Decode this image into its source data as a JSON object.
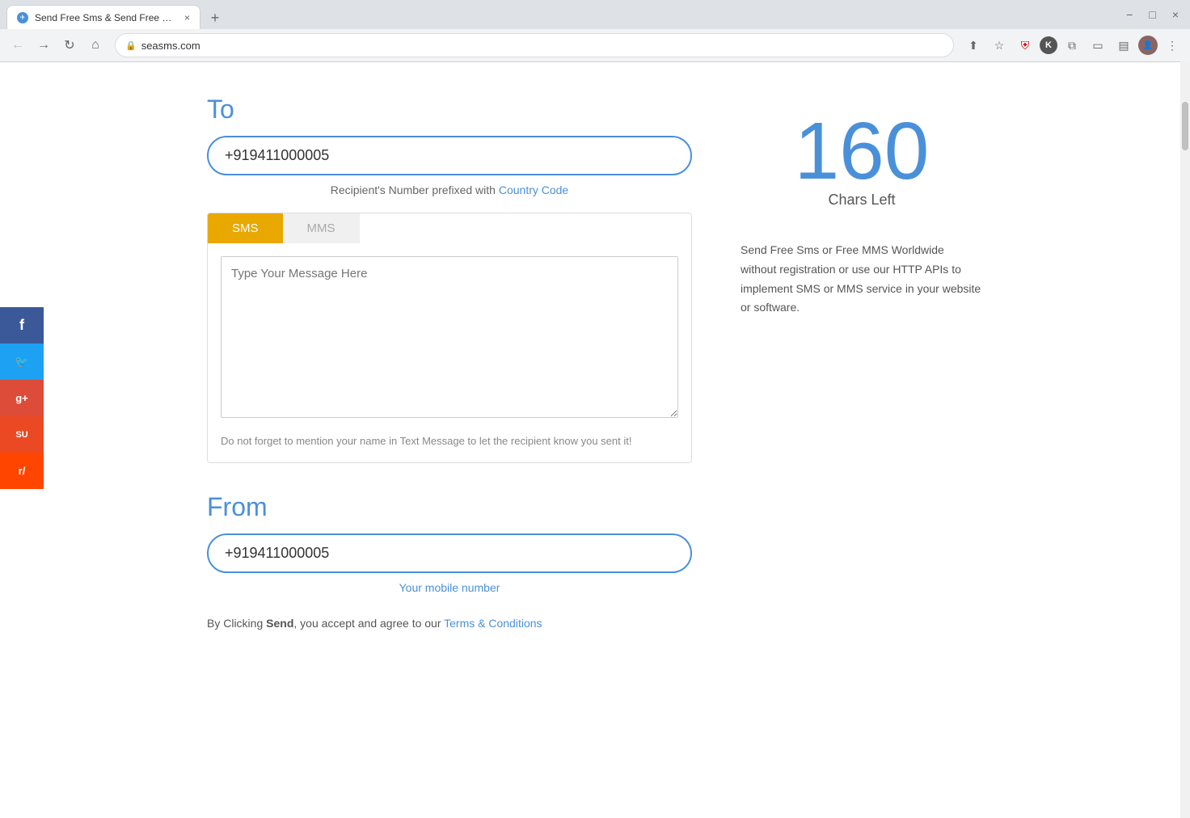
{
  "browser": {
    "tab_title": "Send Free Sms & Send Free MM",
    "tab_favicon": "✈",
    "new_tab_btn": "+",
    "address": "seasms.com",
    "lock_icon": "🔒",
    "win_min": "−",
    "win_restore": "□",
    "win_close": "×",
    "win_list": "⌄"
  },
  "social": [
    {
      "id": "facebook",
      "label": "f",
      "color": "#3b5998"
    },
    {
      "id": "twitter",
      "label": "🐦",
      "color": "#1da1f2"
    },
    {
      "id": "google-plus",
      "label": "g+",
      "color": "#dd4b39"
    },
    {
      "id": "stumbleupon",
      "label": "SU",
      "color": "#eb4924"
    },
    {
      "id": "reddit",
      "label": "r/",
      "color": "#ff4500"
    }
  ],
  "to_label": "To",
  "to_placeholder": "+919411000005",
  "to_hint_prefix": "Recipient's Number prefixed with ",
  "to_hint_link": "Country Code",
  "tabs": [
    {
      "id": "sms",
      "label": "SMS",
      "active": true
    },
    {
      "id": "mms",
      "label": "MMS",
      "active": false
    }
  ],
  "message_placeholder": "Type Your Message Here",
  "message_note": "Do not forget to mention your name in Text Message to let the recipient know you sent it!",
  "from_label": "From",
  "from_placeholder": "+919411000005",
  "from_hint": "Your mobile number",
  "chars_left": "160",
  "chars_left_label": "Chars Left",
  "promo_text": "Send Free Sms or Free MMS Worldwide without registration or use our HTTP APIs to implement SMS or MMS service in your website or software.",
  "terms_prefix": "By Clicking ",
  "terms_send": "Send",
  "terms_middle": ", you accept and agree to our ",
  "terms_link": "Terms & Conditions"
}
